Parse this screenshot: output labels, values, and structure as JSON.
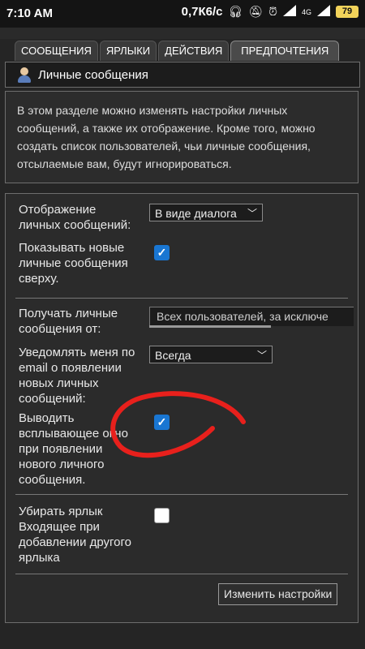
{
  "status": {
    "time": "7:10 AM",
    "speed": "0,7К6/с",
    "battery": "79",
    "net": "4G"
  },
  "tabs": [
    "СООБЩЕНИЯ",
    "ЯРЛЫКИ",
    "ДЕЙСТВИЯ",
    "ПРЕДПОЧТЕНИЯ"
  ],
  "header": {
    "title": "Личные сообщения"
  },
  "info": "В этом разделе можно изменять настройки личных сообщений, а также их отображение. Кроме того, можно создать список пользователей, чьи личные сообщения, отсылаемые вам, будут игнорироваться.",
  "settings": {
    "display_label_1": "Отображение",
    "display_label_2": "личных сообщений:",
    "display_value": "В виде диалога",
    "newtop_label_1": "Показывать новые",
    "newtop_label_2": "личные сообщения",
    "newtop_label_3": "сверху.",
    "receive_label_1": "Получать личные",
    "receive_label_2": "сообщения от:",
    "receive_value": "Всех пользователей, за исключе",
    "notify_label_1": "Уведомлять меня по",
    "notify_label_2": "email о появлении",
    "notify_label_3": "новых личных",
    "notify_label_4": "сообщений:",
    "notify_value": "Всегда",
    "popup_label_1": "Выводить",
    "popup_label_2": "всплывающее окно",
    "popup_label_3": "при появлении",
    "popup_label_4": "нового личного",
    "popup_label_5": "сообщения.",
    "remove_label_1": "Убирать ярлык",
    "remove_label_2": "Входящее при",
    "remove_label_3": "добавлении другого",
    "remove_label_4": "ярлыка",
    "submit": "Изменить настройки"
  },
  "checkbox_mark": "✓",
  "colors": {
    "checkbox_on": "#1976d2",
    "annotation": "#e8201c"
  }
}
